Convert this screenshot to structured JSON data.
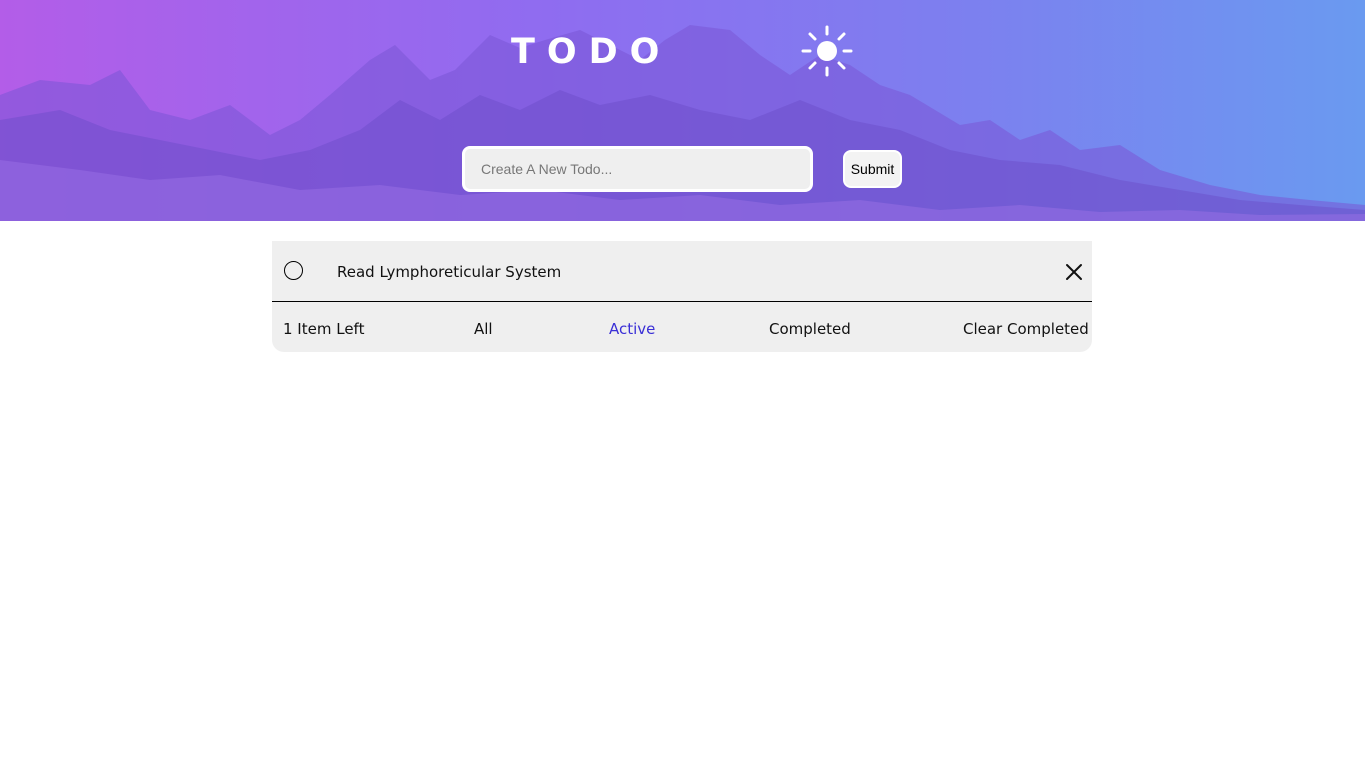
{
  "header": {
    "title": "TODO",
    "theme_icon": "sun-icon"
  },
  "new_todo": {
    "placeholder": "Create A New Todo...",
    "value": "",
    "submit_label": "Submit"
  },
  "todos": [
    {
      "text": "Read Lymphoreticular System",
      "completed": false,
      "check_icon": "circle-icon",
      "delete_icon": "close-icon"
    }
  ],
  "footer": {
    "items_left": "1 Item Left",
    "filters": {
      "all": "All",
      "active": "Active",
      "completed": "Completed"
    },
    "active_filter": "active",
    "clear_completed": "Clear Completed"
  },
  "colors": {
    "active_filter": "#3a2fd6",
    "card_background": "#efefef",
    "header_gradient_start": "#b35de8",
    "header_gradient_end": "#6a9af0"
  }
}
